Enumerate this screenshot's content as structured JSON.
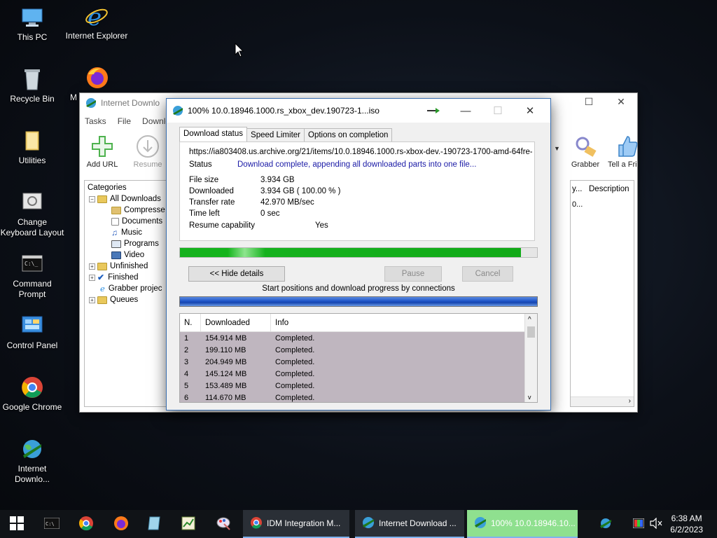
{
  "desktop": {
    "icons": [
      {
        "label": "This PC"
      },
      {
        "label": "Internet Explorer"
      },
      {
        "label": "Recycle Bin"
      },
      {
        "label": "M"
      },
      {
        "label": "Utilities"
      },
      {
        "label": "Change Keyboard Layout"
      },
      {
        "label": "Command Prompt"
      },
      {
        "label": "Control Panel"
      },
      {
        "label": "Google Chrome"
      },
      {
        "label": "Internet Downlo..."
      }
    ]
  },
  "idm_main": {
    "title": "Internet Downlo",
    "menu": [
      "Tasks",
      "File",
      "Downlo"
    ],
    "toolbar": {
      "add_url": "Add URL",
      "resume": "Resume",
      "grabber": "Grabber",
      "tell_friend": "Tell a Fri"
    },
    "categories_title": "Categories",
    "categories": [
      {
        "label": "All Downloads"
      },
      {
        "label": "Compresse"
      },
      {
        "label": "Documents"
      },
      {
        "label": "Music"
      },
      {
        "label": "Programs"
      },
      {
        "label": "Video"
      },
      {
        "label": "Unfinished"
      },
      {
        "label": "Finished"
      },
      {
        "label": "Grabber projec"
      },
      {
        "label": "Queues"
      }
    ],
    "list_columns": {
      "col1": "y...",
      "description": "Description"
    },
    "list_first_row": "0..."
  },
  "dialog": {
    "title": "100% 10.0.18946.1000.rs_xbox_dev.190723-1...iso",
    "tabs": [
      "Download status",
      "Speed Limiter",
      "Options on completion"
    ],
    "url": "https://ia803408.us.archive.org/21/items/10.0.18946.1000.rs-xbox-dev.-190723-1700-amd-64fre-",
    "status_label": "Status",
    "status_value": "Download complete, appending all downloaded parts into one file...",
    "file_size_label": "File size",
    "file_size_value": "3.934  GB",
    "downloaded_label": "Downloaded",
    "downloaded_value": "3.934  GB  ( 100.00 % )",
    "transfer_rate_label": "Transfer rate",
    "transfer_rate_value": "42.970  MB/sec",
    "time_left_label": "Time left",
    "time_left_value": "0 sec",
    "resume_label": "Resume capability",
    "resume_value": "Yes",
    "progress_fraction": 0.955,
    "hide_details": "<< Hide details",
    "pause": "Pause",
    "cancel": "Cancel",
    "connections_caption": "Start positions and download progress by connections",
    "table_headers": {
      "n": "N.",
      "downloaded": "Downloaded",
      "info": "Info"
    },
    "connections": [
      {
        "n": "1",
        "downloaded": "154.914  MB",
        "info": "Completed."
      },
      {
        "n": "2",
        "downloaded": "199.110  MB",
        "info": "Completed."
      },
      {
        "n": "3",
        "downloaded": "204.949  MB",
        "info": "Completed."
      },
      {
        "n": "4",
        "downloaded": "145.124  MB",
        "info": "Completed."
      },
      {
        "n": "5",
        "downloaded": "153.489  MB",
        "info": "Completed."
      },
      {
        "n": "6",
        "downloaded": "114.670  MB",
        "info": "Completed."
      }
    ]
  },
  "taskbar": {
    "tasks": [
      {
        "label": "IDM Integration M..."
      },
      {
        "label": "Internet Download ..."
      },
      {
        "label": "100% 10.0.18946.10..."
      }
    ],
    "time": "6:38 AM",
    "date": "6/2/2023"
  },
  "colors": {
    "accent_blue": "#1a1aa6",
    "progress_green": "#16b21e",
    "taskbar": "#101317"
  }
}
